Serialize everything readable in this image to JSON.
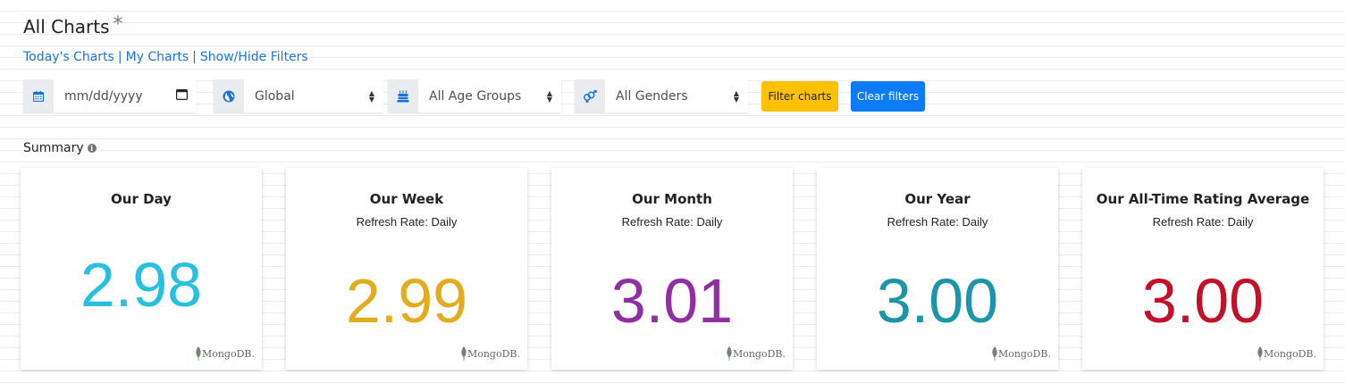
{
  "header": {
    "title": "All Charts",
    "asterisk": "*"
  },
  "nav": {
    "todays_charts": "Today's Charts",
    "my_charts": "My Charts",
    "show_hide_filters": "Show/Hide Filters",
    "separator": "|"
  },
  "filters": {
    "date": {
      "placeholder": "mm/dd/yyyy",
      "icon": "calendar-icon"
    },
    "region": {
      "value": "Global",
      "icon": "globe-icon"
    },
    "age": {
      "value": "All Age Groups",
      "icon": "birthday-cake-icon"
    },
    "gender": {
      "value": "All Genders",
      "icon": "gender-icon"
    },
    "filter_button": "Filter charts",
    "clear_button": "Clear filters",
    "filter_button_color": "#ffc107",
    "clear_button_color": "#0d7bf6"
  },
  "summary": {
    "label": "Summary",
    "cards": [
      {
        "title": "Our Day",
        "subtitle": "",
        "value": "2.98",
        "color": "#26c0e0",
        "logo": "MongoDB."
      },
      {
        "title": "Our Week",
        "subtitle": "Refresh Rate: Daily",
        "value": "2.99",
        "color": "#e2ac1f",
        "logo": "MongoDB."
      },
      {
        "title": "Our Month",
        "subtitle": "Refresh Rate: Daily",
        "value": "3.01",
        "color": "#8f2fa2",
        "logo": "MongoDB."
      },
      {
        "title": "Our Year",
        "subtitle": "Refresh Rate: Daily",
        "value": "3.00",
        "color": "#1a96a8",
        "logo": "MongoDB."
      },
      {
        "title": "Our All-Time Rating Average",
        "subtitle": "Refresh Rate: Daily",
        "value": "3.00",
        "color": "#c4102a",
        "logo": "MongoDB."
      }
    ]
  }
}
